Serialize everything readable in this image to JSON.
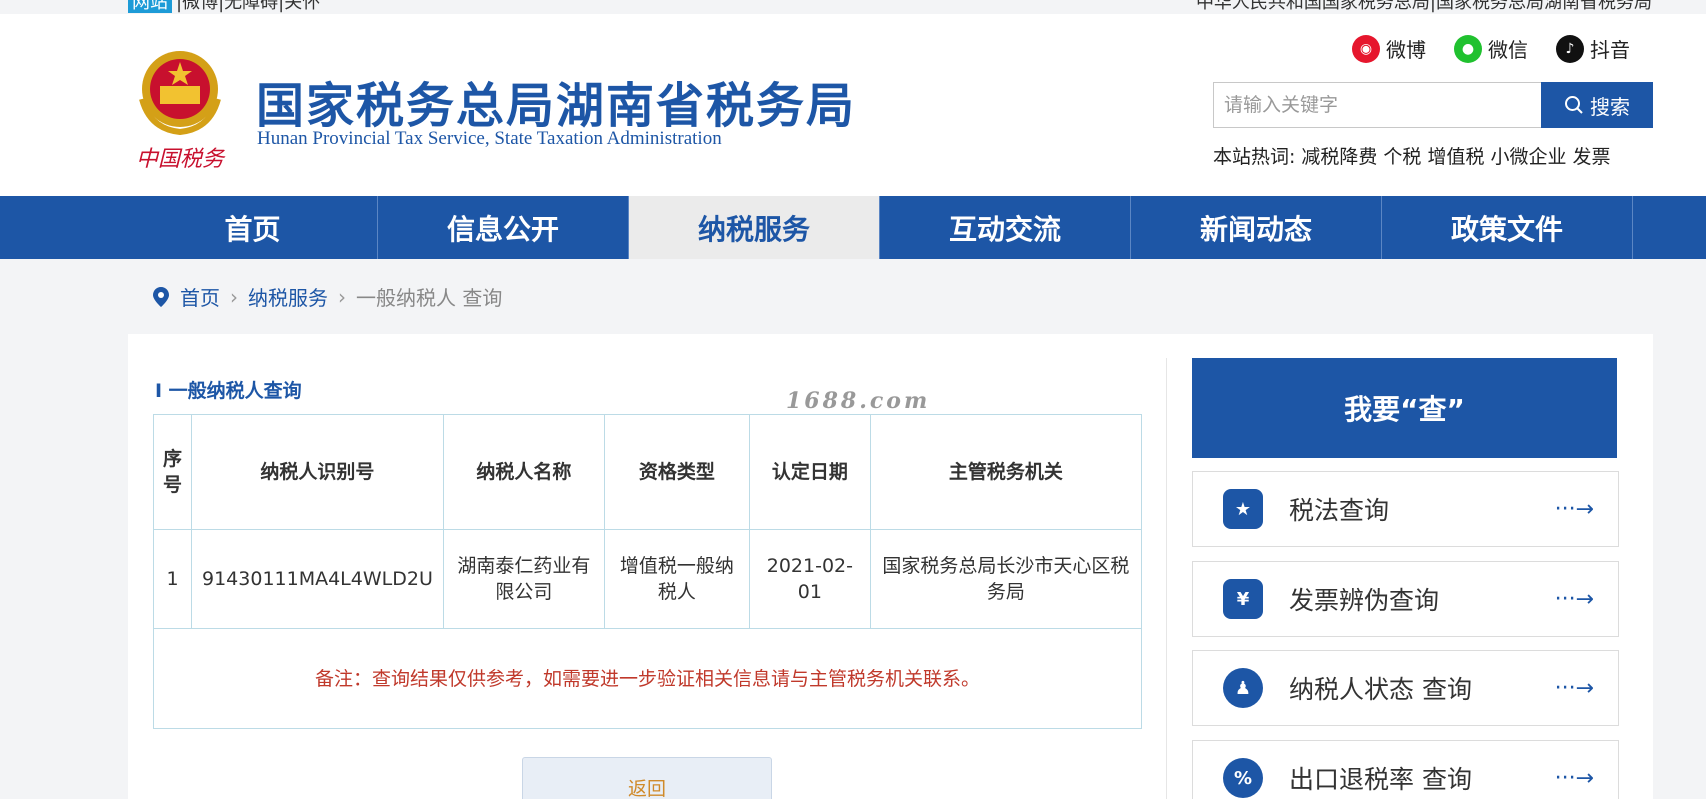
{
  "topbar": {
    "left_tag": "网站",
    "left_text": "|微博|无障碍|关怀",
    "right_text": "中华人民共和国国家税务总局|国家税务总局湖南省税务局"
  },
  "header": {
    "title": "国家税务总局湖南省税务局",
    "subtitle": "Hunan Provincial  Tax Service,  State Taxation Administration",
    "emblem_text": "中国税务",
    "social": [
      {
        "label": "微博",
        "icon": "weibo-icon"
      },
      {
        "label": "微信",
        "icon": "wechat-icon"
      },
      {
        "label": "抖音",
        "icon": "douyin-icon"
      }
    ],
    "search": {
      "placeholder": "请输入关键字",
      "button_label": "搜索"
    },
    "hot": {
      "label": "本站热词:",
      "words": [
        "减税降费",
        "个税",
        "增值税",
        "小微企业",
        "发票"
      ]
    }
  },
  "nav": {
    "items": [
      "首页",
      "信息公开",
      "纳税服务",
      "互动交流",
      "新闻动态",
      "政策文件"
    ],
    "active": "纳税服务"
  },
  "breadcrumb": {
    "items": [
      "首页",
      "纳税服务"
    ],
    "current": "一般纳税人 查询"
  },
  "main": {
    "section_title": "I 一般纳税人查询",
    "table": {
      "headers": [
        "序号",
        "纳税人识别号",
        "纳税人名称",
        "资格类型",
        "认定日期",
        "主管税务机关"
      ],
      "rows": [
        [
          "1",
          "91430111MA4L4WLD2U",
          "湖南泰仁药业有限公司",
          "增值税一般纳税人",
          "2021-02-01",
          "国家税务总局长沙市天心区税务局"
        ]
      ],
      "note": "备注：查询结果仅供参考，如需要进一步验证相关信息请与主管税务机关联系。"
    },
    "back_label": "返回",
    "watermark": "1688.com"
  },
  "sidebar": {
    "title": "我要“查”",
    "items": [
      {
        "label": "税法查询",
        "icon": "law-book-icon"
      },
      {
        "label": "发票辨伪查询",
        "icon": "yuan-invoice-icon"
      },
      {
        "label": "纳税人状态 查询",
        "icon": "taxpayer-search-icon"
      },
      {
        "label": "出口退税率 查询",
        "icon": "percent-icon"
      }
    ],
    "arrow": "···→"
  },
  "colors": {
    "brand_blue": "#1d56a6",
    "note_red": "#c0392b",
    "table_border": "#bcdbe6"
  }
}
